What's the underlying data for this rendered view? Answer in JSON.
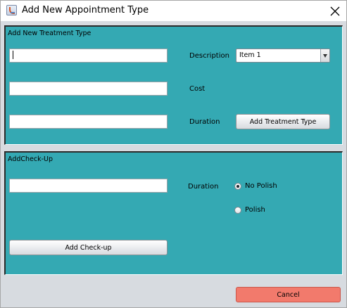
{
  "window": {
    "title": "Add New Appointment Type"
  },
  "treatment": {
    "panel_title": "Add New Treatment Type",
    "field1_value": "",
    "field2_value": "",
    "field3_value": "",
    "description_label": "Description",
    "description_selected": "Item 1",
    "cost_label": "Cost",
    "duration_label": "Duration",
    "add_button_label": "Add Treatment Type"
  },
  "checkup": {
    "panel_title": "AddCheck-Up",
    "field_value": "",
    "duration_label": "Duration",
    "radio_options": [
      {
        "label": "No Polish",
        "checked": true
      },
      {
        "label": "Polish",
        "checked": false
      }
    ],
    "add_button_label": "Add Check-up"
  },
  "footer": {
    "cancel_label": "Cancel"
  },
  "colors": {
    "panel_bg": "#34a9b3",
    "window_bg": "#d7dbe0",
    "cancel_bg": "#f27a6c"
  },
  "icons": {
    "app": "java-app-icon",
    "close": "close-icon",
    "dropdown": "chevron-down-icon"
  }
}
